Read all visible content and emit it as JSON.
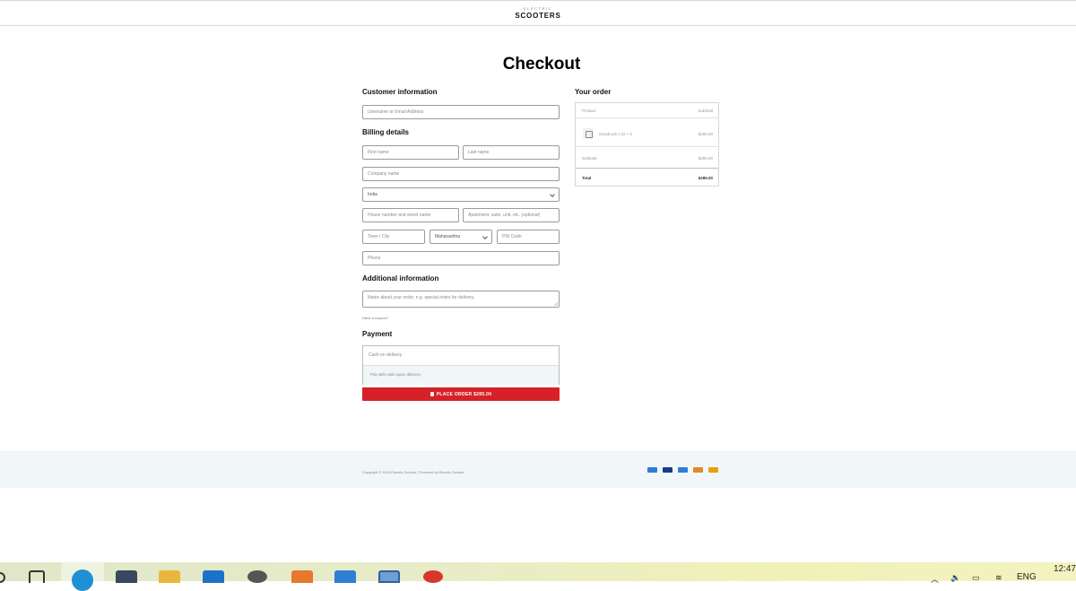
{
  "header": {
    "logo_small": "ELECTRIC",
    "logo_main": "SCOOTERS"
  },
  "page": {
    "title": "Checkout"
  },
  "customer": {
    "heading": "Customer information",
    "username_placeholder": "Username or Email Address"
  },
  "billing": {
    "heading": "Billing details",
    "first_name_placeholder": "First name",
    "last_name_placeholder": "Last name",
    "company_placeholder": "Company name",
    "country_value": "India",
    "street_placeholder": "House number and street name",
    "apartment_placeholder": "Apartment, suite, unit, etc. (optional)",
    "city_placeholder": "Town / City",
    "state_value": "Maharashtra",
    "pin_placeholder": "PIN Code",
    "phone_placeholder": "Phone"
  },
  "additional": {
    "heading": "Additional information",
    "notes_placeholder": "Notes about your order, e.g. special notes for delivery.",
    "coupon_link": "Have a coupon?"
  },
  "payment": {
    "heading": "Payment",
    "method": "Cash on delivery",
    "description": "Pay with cash upon delivery.",
    "place_order_label": "PLACE ORDER $285.00"
  },
  "order": {
    "heading": "Your order",
    "col_product": "Product",
    "col_subtotal": "Subtotal",
    "item_name": "GoodLuck | 10 × 3",
    "item_price": "$285.00",
    "subtotal_label": "Subtotal",
    "subtotal_value": "$285.00",
    "total_label": "Total",
    "total_value": "$285.00"
  },
  "footer": {
    "copyright": "Copyright © 2024 Electric Scooter | Powered by Electric Scooter",
    "card_icons": [
      "amex-card-icon",
      "visa-card-icon",
      "amex-card-icon",
      "discover-card-icon",
      "mastercard-card-icon"
    ],
    "card_colors": [
      "#2e7dd6",
      "#1a3a8a",
      "#2e7dd6",
      "#e08a2a",
      "#e8a20c"
    ]
  },
  "taskbar": {
    "language": "ENG",
    "time": "12:47",
    "apps": [
      "task-view-icon",
      "edge-browser-icon",
      "chart-app-icon",
      "file-explorer-icon",
      "mail-icon",
      "settings-icon",
      "xampp-icon",
      "vscode-icon",
      "paint-icon",
      "filezilla-icon"
    ]
  }
}
